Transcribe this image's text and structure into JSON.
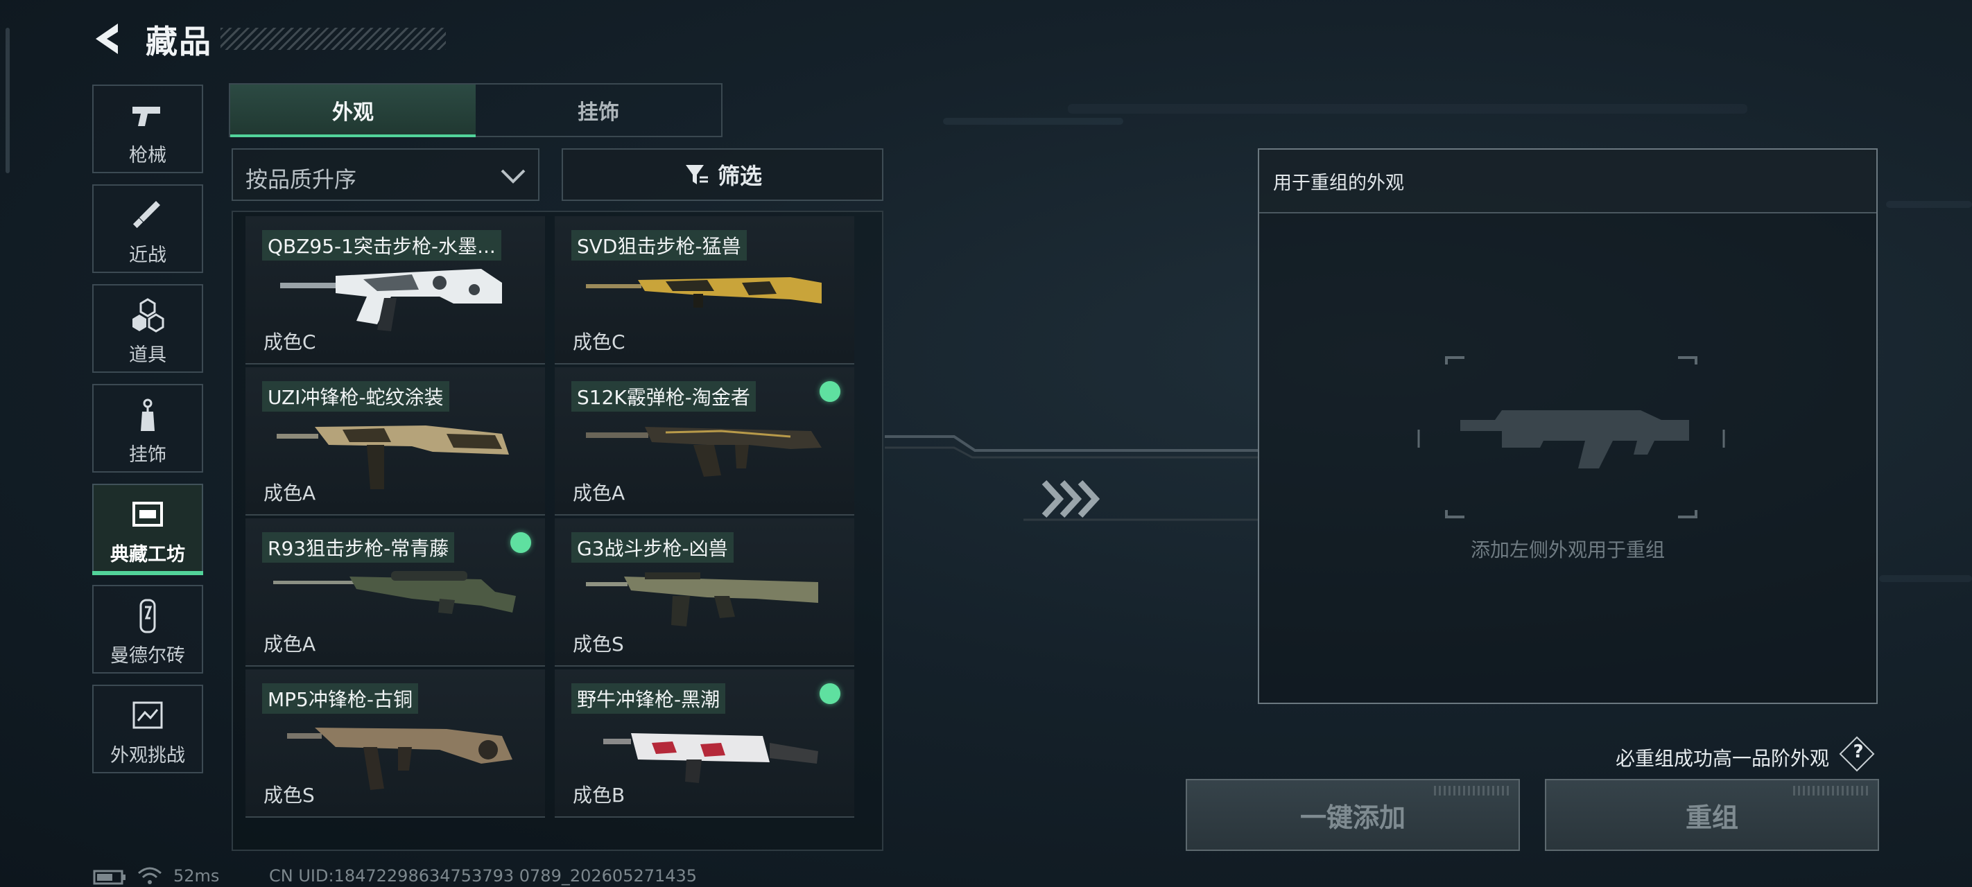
{
  "header": {
    "title": "藏品",
    "back_icon": "back-arrow-icon"
  },
  "sidebar": {
    "items": [
      {
        "label": "枪械",
        "icon": "pistol-icon"
      },
      {
        "label": "近战",
        "icon": "knife-icon"
      },
      {
        "label": "道具",
        "icon": "grenade-icon"
      },
      {
        "label": "挂饰",
        "icon": "charm-icon"
      },
      {
        "label": "典藏工坊",
        "icon": "workshop-icon",
        "active": true
      },
      {
        "label": "曼德尔砖",
        "icon": "brick-icon"
      },
      {
        "label": "外观挑战",
        "icon": "challenge-icon"
      }
    ]
  },
  "tabs": [
    {
      "label": "外观",
      "active": true
    },
    {
      "label": "挂饰",
      "active": false
    }
  ],
  "sort": {
    "value": "按品质升序"
  },
  "filter": {
    "label": "筛选"
  },
  "items": [
    {
      "name": "QBZ95-1突击步枪-水墨...",
      "grade": "成色C",
      "badge": false
    },
    {
      "name": "SVD狙击步枪-猛兽",
      "grade": "成色C",
      "badge": false
    },
    {
      "name": "UZI冲锋枪-蛇纹涂装",
      "grade": "成色A",
      "badge": false
    },
    {
      "name": "S12K霰弹枪-淘金者",
      "grade": "成色A",
      "badge": true
    },
    {
      "name": "R93狙击步枪-常青藤",
      "grade": "成色A",
      "badge": true
    },
    {
      "name": "G3战斗步枪-凶兽",
      "grade": "成色S",
      "badge": false
    },
    {
      "name": "MP5冲锋枪-古铜",
      "grade": "成色S",
      "badge": false
    },
    {
      "name": "野牛冲锋枪-黑潮",
      "grade": "成色B",
      "badge": true
    }
  ],
  "recombine": {
    "panel_title": "用于重组的外观",
    "hint": "添加左侧外观用于重组",
    "note": "必重组成功高一品阶外观",
    "help_icon": "?",
    "add_button": "一键添加",
    "recombine_button": "重组"
  },
  "status": {
    "ping": "52ms",
    "uid": "CN UID:18472298634753793 0789_202605271435"
  },
  "colors": {
    "accent": "#52d39a",
    "badge": "#5fe0a0"
  }
}
